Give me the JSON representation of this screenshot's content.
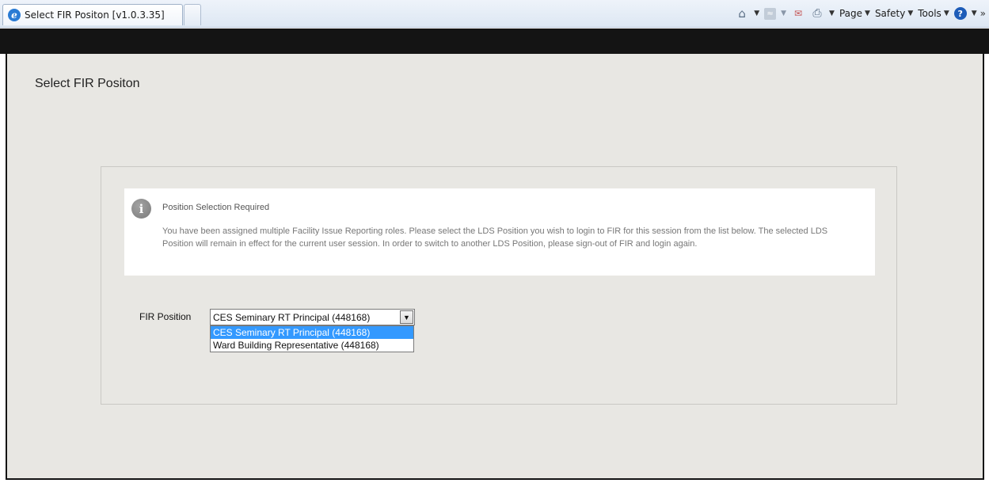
{
  "browser": {
    "tab_title": "Select FIR Positon [v1.0.3.35]",
    "icons": [
      "ie-logo-icon",
      "home-icon",
      "feeds-icon",
      "read-mail-icon",
      "print-icon",
      "help-icon",
      "chevron-more-icon"
    ],
    "menus": {
      "page": "Page",
      "safety": "Safety",
      "tools": "Tools"
    }
  },
  "page": {
    "title": "Select FIR Positon"
  },
  "notice": {
    "heading": "Position Selection Required",
    "body": "You have been assigned multiple Facility Issue Reporting roles. Please select the LDS Position you wish to login to FIR for this session from the list below. The selected LDS Position will remain in effect for the current user session. In order to switch to another LDS Position, please sign-out of FIR and login again."
  },
  "form": {
    "position_label": "FIR Position",
    "selected_value": "CES Seminary RT Principal (448168)",
    "options": [
      "CES Seminary RT Principal (448168)",
      "Ward Building Representative (448168)"
    ]
  },
  "colors": {
    "page_background": "#e8e7e3",
    "header_band": "#141414",
    "selected_option": "#3399ff"
  }
}
